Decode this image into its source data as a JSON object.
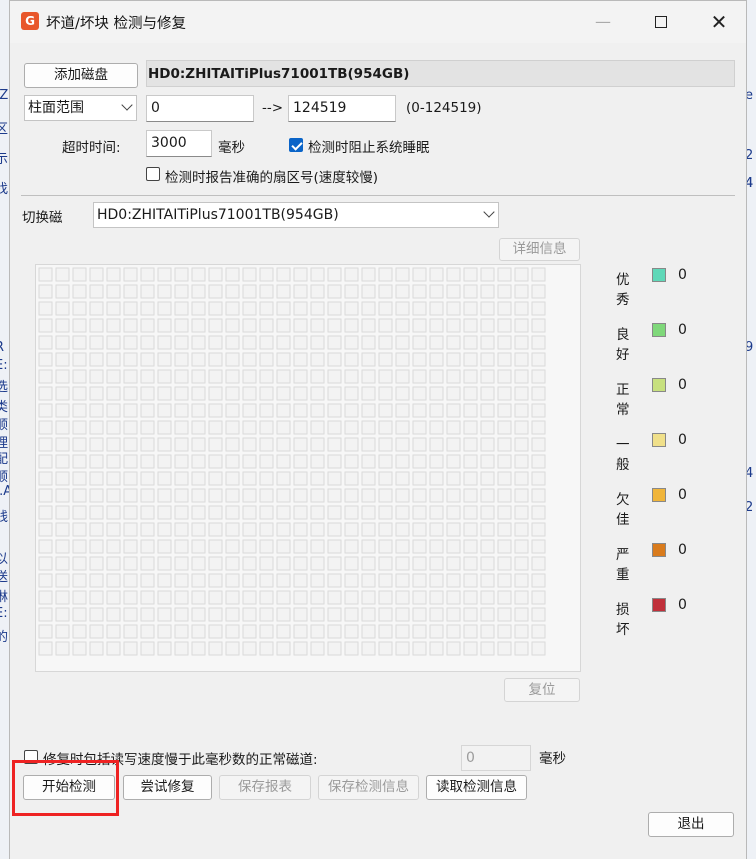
{
  "window": {
    "title": "坏道/坏块 检测与修复",
    "app_icon_glyph": "G",
    "minimize_glyph": "—",
    "close_glyph": "✕"
  },
  "top": {
    "add_disk_label": "添加磁盘",
    "disk_name": "HD0:ZHITAITiPlus71001TB(954GB)",
    "range_mode": "柱面范围",
    "range_start": "0",
    "range_arrow": "-->",
    "range_end": "124519",
    "range_hint": "(0-124519)",
    "timeout_label": "超时时间:",
    "timeout_value": "3000",
    "timeout_unit": "毫秒",
    "prevent_sleep_label": "检测时阻止系统睡眠",
    "prevent_sleep_checked": true,
    "report_sector_label": "检测时报告准确的扇区号(速度较慢)",
    "report_sector_checked": false
  },
  "switch": {
    "label": "切换磁",
    "selected_disk": "HD0:ZHITAITiPlus71001TB(954GB)",
    "details_label": "详细信息"
  },
  "legend": [
    {
      "label": "优秀",
      "color": "#5fd8b8",
      "count": "0"
    },
    {
      "label": "良好",
      "color": "#7fd87a",
      "count": "0"
    },
    {
      "label": "正常",
      "color": "#c7e07e",
      "count": "0"
    },
    {
      "label": "一般",
      "color": "#f0e08a",
      "count": "0"
    },
    {
      "label": "欠佳",
      "color": "#f0b53a",
      "count": "0"
    },
    {
      "label": "严重",
      "color": "#d97b1c",
      "count": "0"
    },
    {
      "label": "损坏",
      "color": "#c0303a",
      "count": "0"
    }
  ],
  "reset_label": "复位",
  "repair": {
    "slow_track_label": "修复时包括读写速度慢于此毫秒数的正常磁道:",
    "slow_track_checked": false,
    "slow_track_value": "0",
    "slow_track_unit": "毫秒"
  },
  "actions": {
    "start_label": "开始检测",
    "try_repair_label": "尝试修复",
    "save_report_label": "保存报表",
    "save_info_label": "保存检测信息",
    "read_info_label": "读取检测信息",
    "exit_label": "退出"
  },
  "background": {
    "left_fragments": [
      ":Z",
      "区",
      "示",
      "找",
      ":",
      "R",
      "E:",
      "选",
      "类",
      "顺",
      "理",
      "配",
      "顺",
      "..A",
      "线",
      ":",
      "以",
      "送",
      "淋",
      "E:",
      "的"
    ],
    "right_fragments": [
      "e",
      "2",
      "4",
      "4",
      "9",
      "4",
      "2"
    ]
  }
}
